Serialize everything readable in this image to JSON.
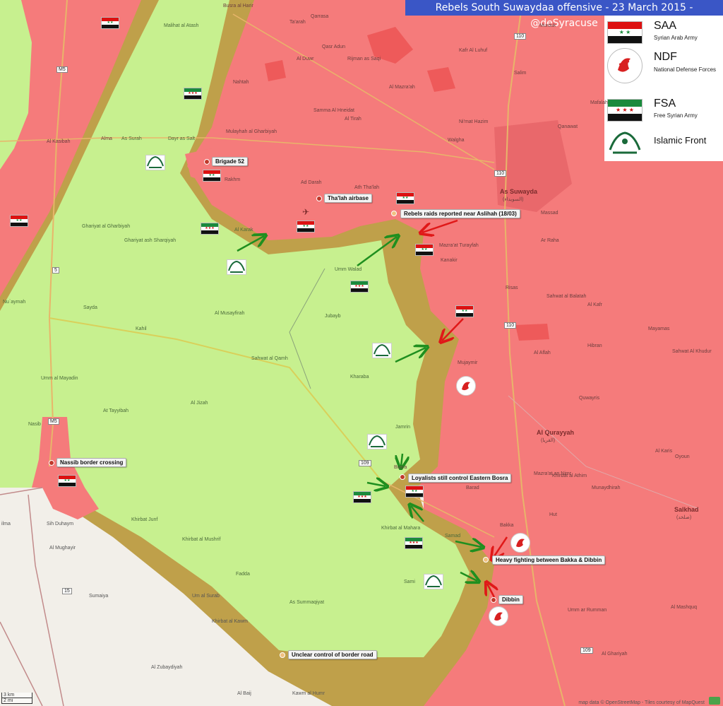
{
  "title": "Rebels South Suwaydaa offensive - 23 March 2015 - @deSyracuse",
  "colors": {
    "saa_area": "#f57b7b",
    "rebel_area": "#c7f08f",
    "contested": "#bfa04a",
    "neutral": "#f2efe9",
    "title_bg": "#3a56c6",
    "arrow_green": "#1f8f1f",
    "arrow_red": "#e01818"
  },
  "legend": [
    {
      "name": "SAA",
      "desc": "Syrian Arab Army",
      "icon": "saa-flag-icon"
    },
    {
      "name": "NDF",
      "desc": "National Defense Forces",
      "icon": "ndf-emblem-icon"
    },
    {
      "name": "FSA",
      "desc": "Free Syrian Army",
      "icon": "fsa-flag-icon"
    },
    {
      "name": "Islamic Front",
      "desc": "",
      "icon": "islamic-front-emblem-icon"
    }
  ],
  "callouts": {
    "brigade52": "Brigade 52",
    "thalah": "Tha'lah airbase",
    "aslihah": "Rebels raids reported near Aslihah (18/03)",
    "bosra": "Loyalists still control Eastern Bosra",
    "bakka": "Heavy fighting between Bakka & Dibbin",
    "dibbin": "Dibbin",
    "nassib": "Nassib border crossing",
    "border_road": "Unclear control of border road"
  },
  "places": {
    "as_suwayda": "As Suwayda",
    "as_suwayda_ar": "(السويداء)",
    "al_qurayyah": "Al Qurayyah",
    "al_qurayyah_ar": "(القريا)",
    "salkhad": "Salkhad",
    "salkhad_ar": "(صلخد)",
    "busra": "Busra",
    "busra_al_harir": "Busra al Harir",
    "malihat_al_atash": "Malihat al Atash",
    "qarrasa": "Qarrasa",
    "ta_arah": "Ta'arah",
    "qasr_adun": "Qasr Adun",
    "al_duwr": "Al Duwr",
    "rijman_as_saqi": "Rijman as Saqi",
    "murduk": "Murduk",
    "kafr_al_luhuf": "Kafr Al Luhuf",
    "al_mazra_ah": "Al Mazra'ah",
    "samma_al_hneidat": "Samma Al Hneidat",
    "al_tirah": "Al Tirah",
    "salim": "Salim",
    "walgha": "Walgha",
    "nimat_hazim": "Ni'mat Hazim",
    "qanawat": "Qanawat",
    "mafalah": "Mafalah",
    "dayr_as_salt": "Dayr as Salt",
    "as_surah": "As Surah",
    "alma": "Alma",
    "al_kasibah": "Al Kasibah",
    "mulayhah_al_gharbiyah": "Mulayhah al Gharbiyah",
    "nahtah": "Nahtah",
    "rakhm": "Rakhm",
    "ad_darah": "Ad Darah",
    "ath_tha_lah": "Ath Tha'lah",
    "mazra_at_turayfah": "Mazra'at Turayfah",
    "kanakir": "Kanakir",
    "massad": "Massad",
    "ar_raha": "Ar Raha",
    "risas": "Risas",
    "sahwat_al_balatah": "Sahwat al Balatah",
    "al_kafr": "Al Kafr",
    "ghariyat_al_gharbiyah": "Ghariyat al Gharbiyah",
    "ghariyat_ash_sharqiyah": "Ghariyat ash Sharqiyah",
    "al_karak": "Al Karak",
    "umm_walad": "Umm Walad",
    "nu_aymah": "Nu`aymah",
    "sayda": "Sayda",
    "kahil": "Kahil",
    "al_musayfirah": "Al Musayfirah",
    "jubayb": "Jubayb",
    "al_aflah": "Al Aflah",
    "hibran": "Hibran",
    "mayamas": "Mayamas",
    "sahwat_al_khudur": "Sahwat Al Khudur",
    "umm_al_mayadin": "Umm al Mayadin",
    "sahwat_al_qamh": "Sahwat al Qamh",
    "kharaba": "Kharaba",
    "mujaymir": "Mujaymir",
    "quwayris": "Quwayris",
    "al_tayyibah": "At Tayyibah",
    "al_jizah": "Al Jizah",
    "nasib": "Nasib",
    "jamrin": "Jamrin",
    "al_karis": "Al Karis",
    "oyoun": "Oyoun",
    "mazra_at_an_nimr": "Mazra'at an Nimr",
    "barad": "Barad",
    "khirbat_al_athim": "Khirbat al Athim",
    "munaydhirah": "Munaydhirah",
    "hut": "Hut",
    "bakka": "Bakka",
    "samad": "Samad",
    "khirbat_al_mahara": "Khirbat al Mahara",
    "sami": "Sami",
    "khirbat_junf": "Khirbat Junf",
    "khirbat_al_mushrif": "Khirbat al Mushrif",
    "fadda": "Fadda",
    "as_summaqiyat": "As Summaqiyat",
    "umm_ar_rumman": "Umm ar Rumman",
    "al_mashquq": "Al Mashquq",
    "al_ghariyah": "Al Ghariyah",
    "sih_duhaym": "Sih Duhaym",
    "al_mughayir": "Al Mughayir",
    "sumaiya": "Sumaiya",
    "um_al_surab": "Um al Surab",
    "khirbat_al_kawm": "Khirbat al Kawm",
    "al_zubaydiyah": "Al Zubaydiyah",
    "kawm_al_humr": "Kawm al Humr",
    "al_baij": "Al Baij",
    "elma": "ilma"
  },
  "roads": {
    "m5_top": "M5",
    "m5_mid": "M5",
    "r110_top": "110",
    "r110_mid": "110",
    "r110_low": "110",
    "r109": "109",
    "r15": "15",
    "r109_low": "109",
    "r5": "5"
  },
  "scale": {
    "km": "3 km",
    "mi": "2 mi"
  },
  "attribution": "map data © OpenStreetMap - Tiles courtesy of MapQuest"
}
